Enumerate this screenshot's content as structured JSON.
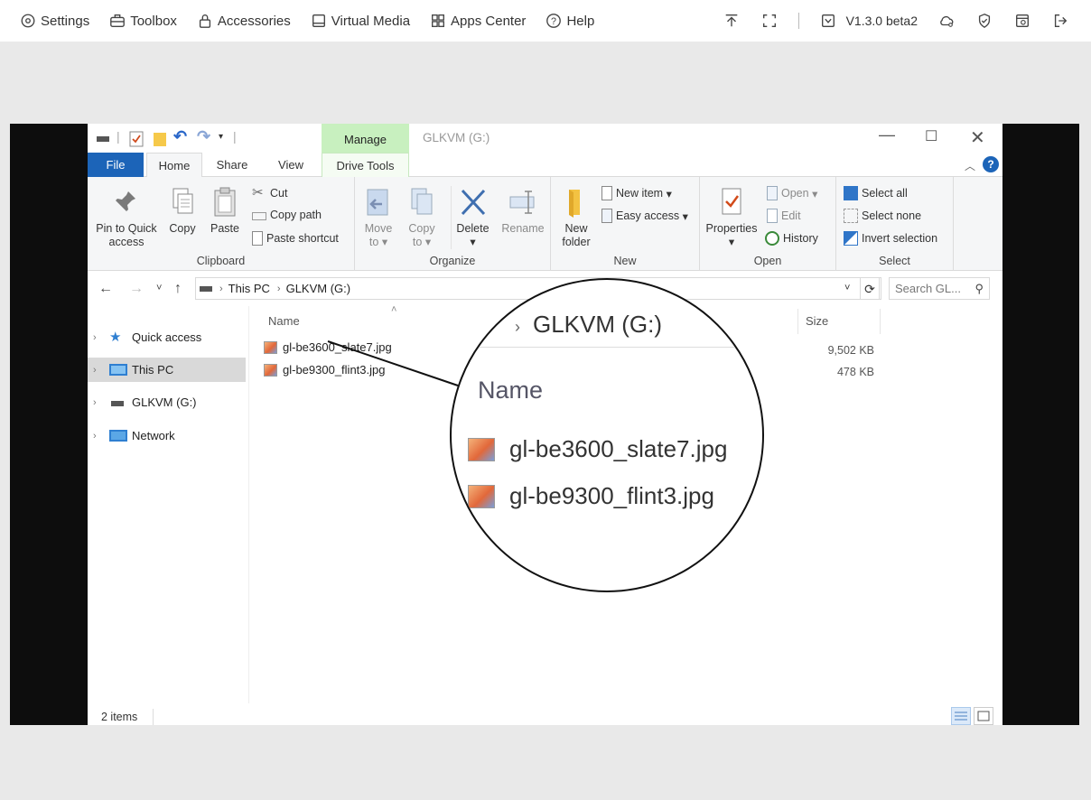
{
  "topbar": {
    "nav": [
      {
        "label": "Settings",
        "icon": "settings-icon"
      },
      {
        "label": "Toolbox",
        "icon": "toolbox-icon"
      },
      {
        "label": "Accessories",
        "icon": "lock-icon"
      },
      {
        "label": "Virtual Media",
        "icon": "drive-icon"
      },
      {
        "label": "Apps Center",
        "icon": "apps-grid-icon"
      },
      {
        "label": "Help",
        "icon": "help-icon"
      }
    ],
    "version": "V1.3.0 beta2"
  },
  "explorer": {
    "window_title": "GLKVM (G:)",
    "manage_label": "Manage",
    "tabs": {
      "file": "File",
      "home": "Home",
      "share": "Share",
      "view": "View",
      "drive_tools": "Drive Tools"
    },
    "ribbon": {
      "clipboard": {
        "label": "Clipboard",
        "pin": "Pin to Quick access",
        "pin_line1": "Pin to Quick",
        "pin_line2": "access",
        "copy": "Copy",
        "paste": "Paste",
        "cut": "Cut",
        "copy_path": "Copy path",
        "paste_shortcut": "Paste shortcut"
      },
      "organize": {
        "label": "Organize",
        "move_to_1": "Move",
        "move_to_2": "to",
        "copy_to_1": "Copy",
        "copy_to_2": "to",
        "delete": "Delete",
        "rename": "Rename"
      },
      "new": {
        "label": "New",
        "new_folder_1": "New",
        "new_folder_2": "folder",
        "new_item": "New item",
        "easy_access": "Easy access"
      },
      "open": {
        "label": "Open",
        "properties": "Properties",
        "open": "Open",
        "edit": "Edit",
        "history": "History"
      },
      "select": {
        "label": "Select",
        "select_all": "Select all",
        "select_none": "Select none",
        "invert": "Invert selection"
      }
    },
    "address": {
      "crumbs": [
        "This PC",
        "GLKVM (G:)"
      ],
      "search_placeholder": "Search GL..."
    },
    "nav_pane": [
      {
        "label": "Quick access",
        "selected": false
      },
      {
        "label": "This PC",
        "selected": true
      },
      {
        "label": "GLKVM (G:)",
        "selected": false
      },
      {
        "label": "Network",
        "selected": false
      }
    ],
    "columns": {
      "name": "Name",
      "size": "Size"
    },
    "files": [
      {
        "name": "gl-be3600_slate7.jpg",
        "size": "9,502 KB"
      },
      {
        "name": "gl-be9300_flint3.jpg",
        "size": "478 KB"
      }
    ],
    "status": "2 items"
  },
  "magnifier": {
    "path": "GLKVM (G:)",
    "column": "Name",
    "files": [
      "gl-be3600_slate7.jpg",
      "gl-be9300_flint3.jpg"
    ]
  }
}
